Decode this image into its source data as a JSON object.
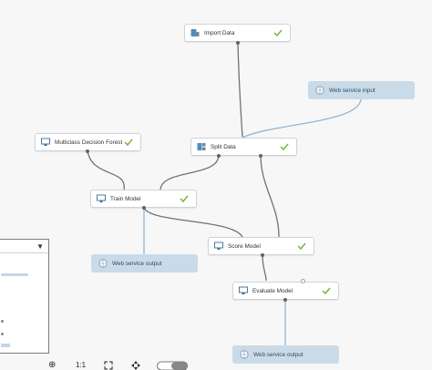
{
  "nodes": {
    "import_data": {
      "label": "Import Data",
      "icon": "database-import-icon"
    },
    "web_service_input": {
      "label": "Web service input",
      "icon": "web-service-globe-icon"
    },
    "multiclass_decision_forest": {
      "label": "Multiclass Decision Forest",
      "icon": "monitor-model-icon"
    },
    "split_data": {
      "label": "Split Data",
      "icon": "split-data-icon"
    },
    "train_model": {
      "label": "Train Model",
      "icon": "monitor-model-icon"
    },
    "web_service_output_1": {
      "label": "Web service output",
      "icon": "web-service-globe-icon"
    },
    "score_model": {
      "label": "Score Model",
      "icon": "monitor-model-icon"
    },
    "evaluate_model": {
      "label": "Evaluate Model",
      "icon": "monitor-model-icon"
    },
    "web_service_output_2": {
      "label": "Web service output",
      "icon": "web-service-globe-icon"
    }
  },
  "status": {
    "icon": "checkmark-icon",
    "color": "#7cb342"
  },
  "colors": {
    "node_bg": "#ffffff",
    "web_service_bg": "#c9dbe8",
    "edge": "#6b737c",
    "edge_web": "#8fb6d3"
  },
  "toolbar": {
    "zoom_in": "⊕",
    "actual_size": "1:1",
    "fit_icon": "fit-to-screen-icon",
    "pan_icon": "move-icon",
    "toggle_icon": "toggle-icon"
  }
}
